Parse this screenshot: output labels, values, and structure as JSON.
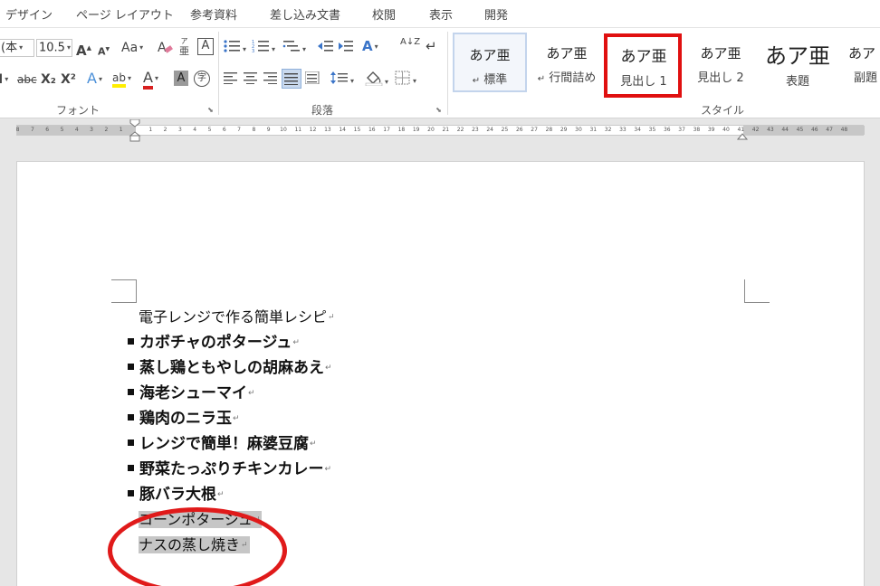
{
  "tabs": [
    "デザイン",
    "ページ レイアウト",
    "参考資料",
    "差し込み文書",
    "校閲",
    "表示",
    "開発"
  ],
  "font": {
    "font_name": "(本",
    "font_size": "10.5",
    "grow_icon": "A",
    "shrink_icon": "A",
    "case_label": "Aa",
    "furigana_label": "亜",
    "furigana_top": "ア",
    "border_char": "A",
    "strikethrough_label": "abc",
    "subscript_label": "X₂",
    "superscript_label": "X²",
    "effects_label": "A",
    "highlight_label": "ab",
    "font_color_label": "A",
    "shading_char": "A",
    "enclose_char": "字",
    "group_label": "フォント"
  },
  "paragraph": {
    "sort_label": "A↓Z",
    "group_label": "段落"
  },
  "styles": {
    "items": [
      {
        "sample": "あア亜",
        "name": "標準",
        "marker": "↵"
      },
      {
        "sample": "あア亜",
        "name": "行間詰め",
        "marker": "↵"
      },
      {
        "sample": "あア亜",
        "name": "見出し 1",
        "marker": ""
      },
      {
        "sample": "あア亜",
        "name": "見出し 2",
        "marker": ""
      },
      {
        "sample": "あア亜",
        "name": "表題",
        "marker": ""
      },
      {
        "sample": "あア",
        "name": "副題",
        "marker": ""
      }
    ],
    "group_label": "スタイル",
    "highlight_color": "#e01010"
  },
  "ruler": {
    "left_labels": [
      "8",
      "7",
      "6",
      "5",
      "4",
      "3",
      "2",
      "1"
    ],
    "right_labels": [
      "1",
      "2",
      "3",
      "4",
      "5",
      "6",
      "7",
      "8",
      "9",
      "10",
      "11",
      "12",
      "13",
      "14",
      "15",
      "16",
      "17",
      "18",
      "19",
      "20",
      "21",
      "22",
      "23",
      "24",
      "25",
      "26",
      "27",
      "28",
      "29",
      "30",
      "31",
      "32",
      "33",
      "34",
      "35",
      "36",
      "37",
      "38",
      "39",
      "40",
      "41",
      "42",
      "43",
      "44",
      "45",
      "46",
      "47",
      "48"
    ]
  },
  "document": {
    "title_line": "電子レンジで作る簡単レシピ",
    "bullets": [
      "カボチャのポタージュ",
      "蒸し鶏ともやしの胡麻あえ",
      "海老シューマイ",
      "鶏肉のニラ玉",
      "レンジで簡単！麻婆豆腐",
      "野菜たっぷりチキンカレー",
      "豚バラ大根"
    ],
    "selected_lines": [
      "コーンポタージュ",
      "ナスの蒸し焼き"
    ],
    "para_mark": "↵",
    "annotation_color": "#e01a1a",
    "selection_color": "#c6c6c6"
  }
}
